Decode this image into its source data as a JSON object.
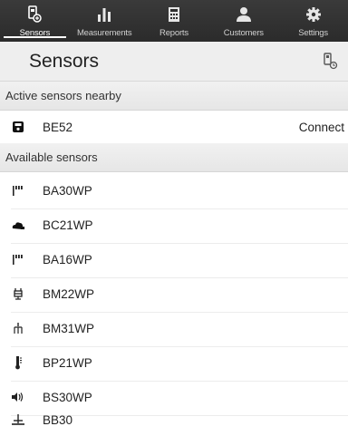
{
  "tabs": [
    {
      "label": "Sensors",
      "icon": "sensor-icon",
      "active": true
    },
    {
      "label": "Measurements",
      "icon": "bar-chart-icon",
      "active": false
    },
    {
      "label": "Reports",
      "icon": "report-icon",
      "active": false
    },
    {
      "label": "Customers",
      "icon": "customers-icon",
      "active": false
    },
    {
      "label": "Settings",
      "icon": "gear-icon",
      "active": false
    }
  ],
  "header": {
    "title": "Sensors",
    "icon": "sensor-search-icon"
  },
  "active_section": {
    "title": "Active sensors nearby",
    "items": [
      {
        "name": "BE52",
        "icon": "device-icon",
        "action": "Connect"
      }
    ]
  },
  "available_section": {
    "title": "Available sensors",
    "items": [
      {
        "name": "BA30WP",
        "icon": "signal-bars-icon"
      },
      {
        "name": "BC21WP",
        "icon": "weather-icon"
      },
      {
        "name": "BA16WP",
        "icon": "signal-bars-icon"
      },
      {
        "name": "BM22WP",
        "icon": "multimeter-icon"
      },
      {
        "name": "BM31WP",
        "icon": "probe-icon"
      },
      {
        "name": "BP21WP",
        "icon": "thermometer-icon"
      },
      {
        "name": "BS30WP",
        "icon": "speaker-icon"
      },
      {
        "name": "BB30",
        "icon": "level-icon"
      }
    ]
  },
  "colors": {
    "tabbar": "#2f2f2f",
    "header": "#eeeeee",
    "section": "#e9e9e9"
  }
}
